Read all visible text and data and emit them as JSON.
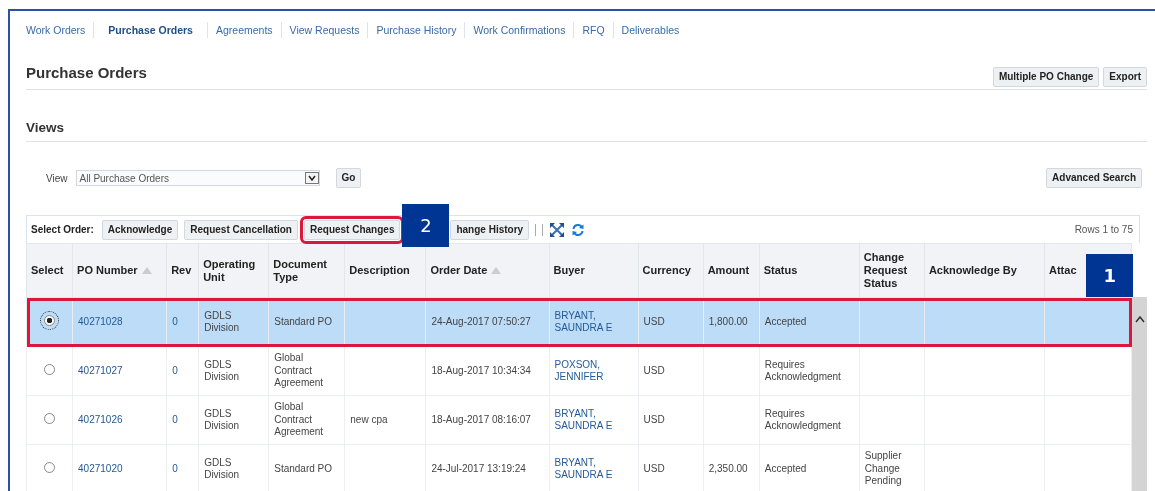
{
  "tabs": [
    {
      "label": "Work Orders",
      "selected": false
    },
    {
      "label": "Purchase Orders",
      "selected": true
    },
    {
      "label": "Agreements",
      "selected": false
    },
    {
      "label": "View Requests",
      "selected": false
    },
    {
      "label": "Purchase History",
      "selected": false
    },
    {
      "label": "Work Confirmations",
      "selected": false
    },
    {
      "label": "RFQ",
      "selected": false
    },
    {
      "label": "Deliverables",
      "selected": false
    }
  ],
  "page_title": "Purchase Orders",
  "header_buttons": [
    "Multiple PO Change",
    "Export"
  ],
  "views": {
    "heading": "Views",
    "label": "View",
    "value": "All Purchase Orders",
    "go": "Go",
    "advanced_search": "Advanced Search"
  },
  "table": {
    "toolbar_label": "Select Order:",
    "actions": [
      {
        "label": "Acknowledge",
        "highlighted": false
      },
      {
        "label": "Request Cancellation",
        "highlighted": false
      },
      {
        "label": "Request Changes",
        "highlighted": true,
        "callout": "2"
      },
      {
        "label": "hange History",
        "highlighted": false
      }
    ],
    "rows_info": "Rows 1 to 75",
    "columns": [
      {
        "label": "Select",
        "kind": "radio",
        "sort_indicator": false
      },
      {
        "label": "PO Number",
        "kind": "link",
        "sort_indicator": true
      },
      {
        "label": "Rev",
        "kind": "link",
        "sort_indicator": false
      },
      {
        "label": "Operating Unit",
        "kind": "text",
        "sort_indicator": false
      },
      {
        "label": "Document Type",
        "kind": "text",
        "sort_indicator": false
      },
      {
        "label": "Description",
        "kind": "text",
        "sort_indicator": false
      },
      {
        "label": "Order Date",
        "kind": "text",
        "sort_indicator": true
      },
      {
        "label": "Buyer",
        "kind": "link",
        "sort_indicator": false
      },
      {
        "label": "Currency",
        "kind": "text",
        "sort_indicator": false
      },
      {
        "label": "Amount",
        "kind": "text",
        "sort_indicator": false
      },
      {
        "label": "Status",
        "kind": "text",
        "sort_indicator": false
      },
      {
        "label": "Change Request Status",
        "kind": "text",
        "sort_indicator": false
      },
      {
        "label": "Acknowledge By",
        "kind": "text",
        "sort_indicator": false
      },
      {
        "label": "Attac",
        "kind": "text",
        "sort_indicator": false,
        "callout": "1"
      }
    ],
    "rows": [
      {
        "selected": true,
        "highlighted": true,
        "cells": [
          null,
          "40271028",
          "0",
          "GDLS Division",
          "Standard PO",
          null,
          "24-Aug-2017 07:50:27",
          "BRYANT, SAUNDRA E",
          "USD",
          "1,800.00",
          "Accepted",
          null,
          null,
          null
        ]
      },
      {
        "selected": false,
        "highlighted": false,
        "cells": [
          null,
          "40271027",
          "0",
          "GDLS Division",
          "Global Contract Agreement",
          null,
          "18-Aug-2017 10:34:34",
          "POXSON, JENNIFER",
          "USD",
          null,
          "Requires Acknowledgment",
          null,
          null,
          null
        ]
      },
      {
        "selected": false,
        "highlighted": false,
        "cells": [
          null,
          "40271026",
          "0",
          "GDLS Division",
          "Global Contract Agreement",
          "new cpa",
          "18-Aug-2017 08:16:07",
          "BRYANT, SAUNDRA E",
          "USD",
          null,
          "Requires Acknowledgment",
          null,
          null,
          null
        ]
      },
      {
        "selected": false,
        "highlighted": false,
        "cells": [
          null,
          "40271020",
          "0",
          "GDLS Division",
          "Standard PO",
          null,
          "24-Jul-2017 13:19:24",
          "BRYANT, SAUNDRA E",
          "USD",
          "2,350.00",
          "Accepted",
          "Supplier Change Pending",
          null,
          null
        ]
      }
    ]
  }
}
